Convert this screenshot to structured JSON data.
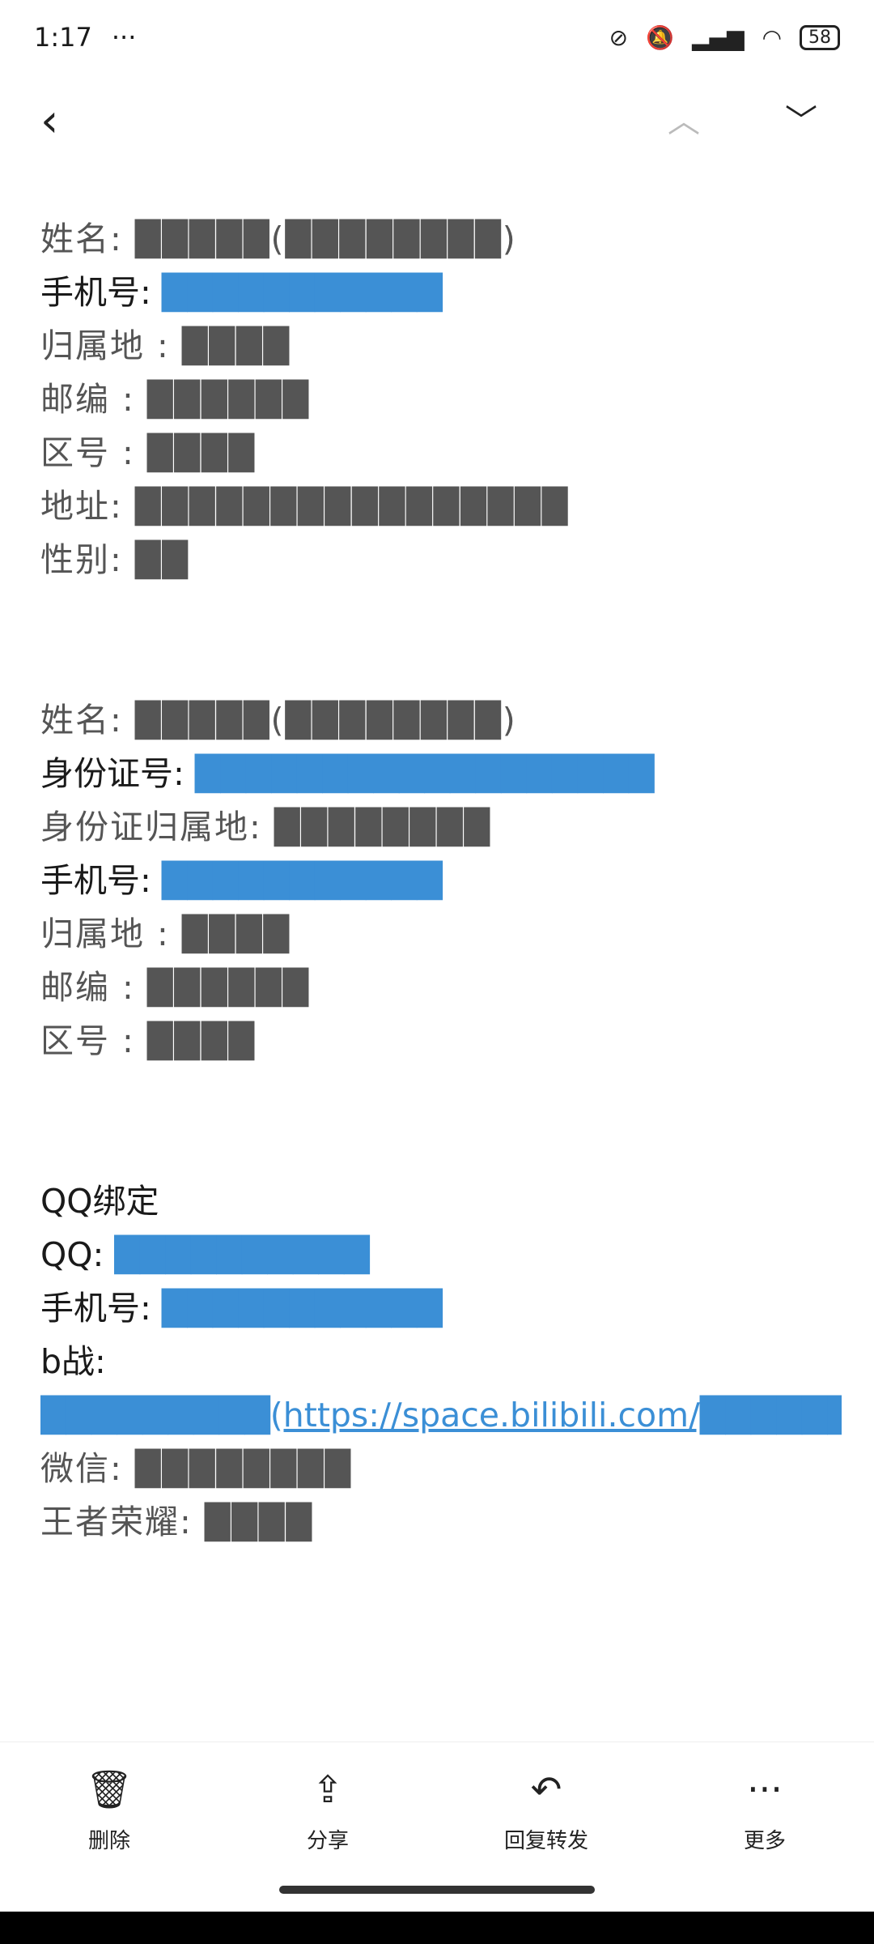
{
  "status": {
    "time": "1:17",
    "dots": "···",
    "battery": "58"
  },
  "toolbar": {
    "delete": "删除",
    "share": "分享",
    "reply": "回复转发",
    "more": "更多"
  },
  "icons": {
    "back": "‹",
    "up": "︿",
    "down": "﹀",
    "more": "···"
  },
  "body": {
    "l1": "姓名: █████(████████)",
    "l2": "手机号: ",
    "v2": "███████████",
    "l3": "归属地 : ████",
    "l4": "邮编 : ██████",
    "l5": "区号 : ████",
    "l6": "地址: ████████████████",
    "l7": "性别: ██",
    "l8": "姓名: █████(████████)",
    "l9": "身份证号: ",
    "v9": "██████████████████",
    "l10": "身份证归属地: ████████",
    "l11": "手机号: ",
    "v11": "███████████",
    "l12": "归属地 : ████",
    "l13": "邮编 : ██████",
    "l14": "区号 : ████",
    "l15": "QQ绑定",
    "l16": "QQ: ",
    "v16": "██████████",
    "l17": "手机号: ",
    "v17": "███████████",
    "l18": "b战:",
    "v19": "█████████(https://space.bilibili.com/█████████)",
    "l20": "微信:  ████████",
    "l21": "王者荣耀:  ████"
  }
}
